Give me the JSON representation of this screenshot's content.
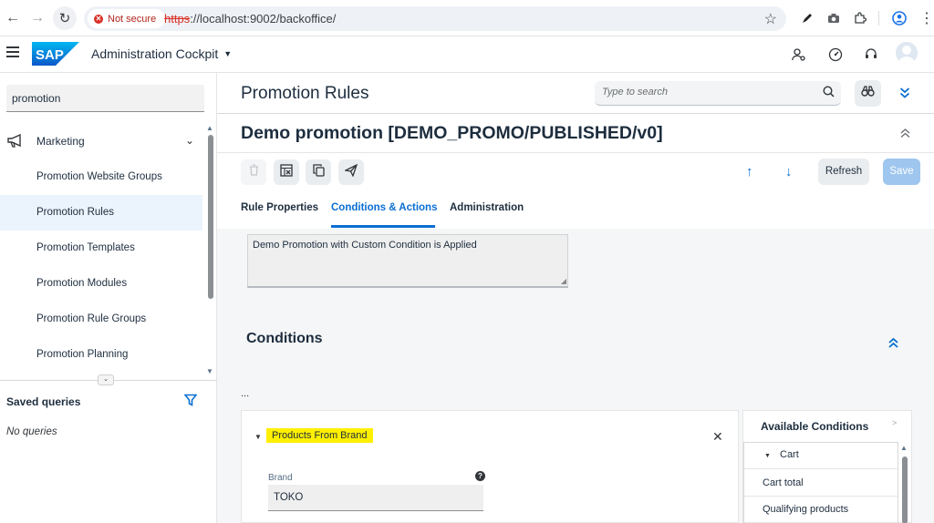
{
  "browser": {
    "not_secure_label": "Not secure",
    "url_scheme": "https",
    "url_rest": "://localhost:9002/backoffice/"
  },
  "shell": {
    "app_title": "Administration Cockpit",
    "brand_color": "#0a6ed1"
  },
  "sidebar": {
    "search_value": "promotion",
    "group_label": "Marketing",
    "items": [
      {
        "label": "Promotion Website Groups",
        "selected": false
      },
      {
        "label": "Promotion Rules",
        "selected": true
      },
      {
        "label": "Promotion Templates",
        "selected": false
      },
      {
        "label": "Promotion Modules",
        "selected": false
      },
      {
        "label": "Promotion Rule Groups",
        "selected": false
      },
      {
        "label": "Promotion Planning",
        "selected": false
      }
    ],
    "saved_queries_title": "Saved queries",
    "no_queries_text": "No queries"
  },
  "main": {
    "page_title": "Promotion Rules",
    "search_placeholder": "Type to search",
    "object_title": "Demo promotion [DEMO_PROMO/PUBLISHED/v0]",
    "refresh_label": "Refresh",
    "save_label": "Save",
    "tabs": [
      {
        "label": "Rule Properties",
        "active": false
      },
      {
        "label": "Conditions & Actions",
        "active": true
      },
      {
        "label": "Administration",
        "active": false
      }
    ],
    "description_text": "Demo Promotion with Custom Condition is Applied",
    "conditions_heading": "Conditions",
    "ellipsis": "...",
    "condition": {
      "name": "Products From Brand",
      "brand_label": "Brand",
      "brand_value": "TOKO"
    },
    "available_conditions": {
      "title": "Available Conditions",
      "group": "Cart",
      "items": [
        "Cart total",
        "Qualifying products"
      ]
    }
  }
}
